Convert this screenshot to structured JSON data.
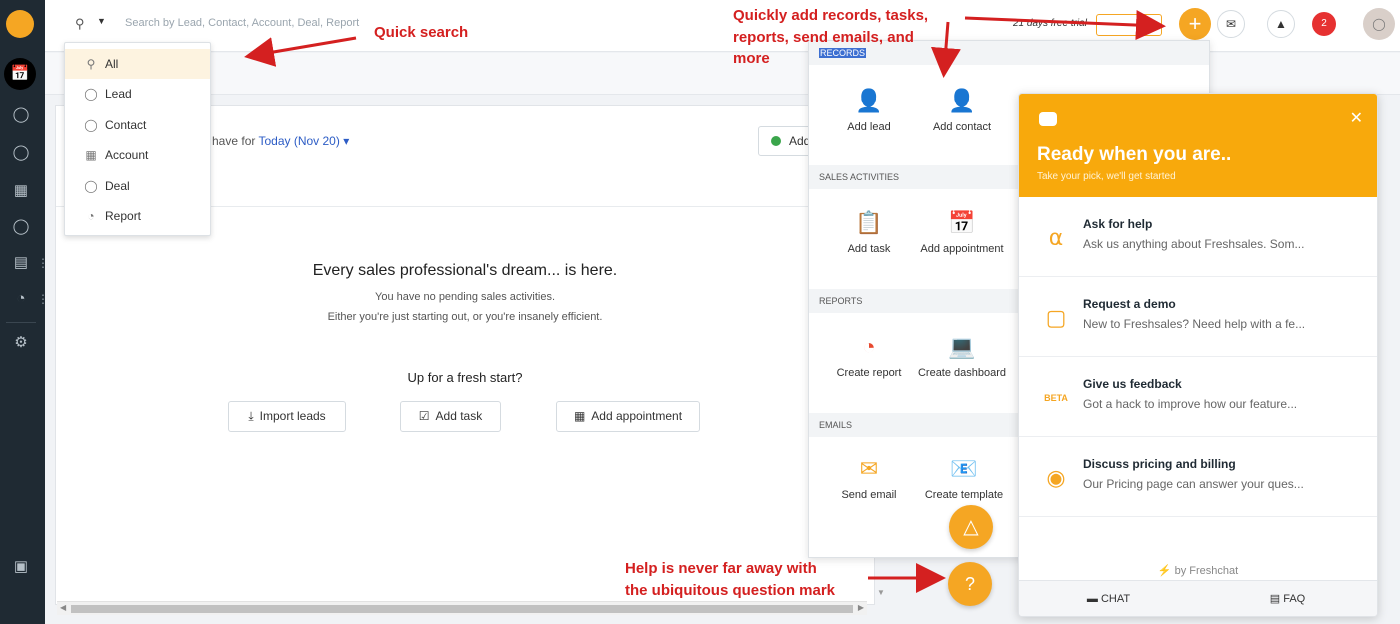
{
  "topbar": {
    "search_placeholder": "Search by Lead, Contact, Account, Deal, Report",
    "trial_text": "21 days free trial",
    "plus_icon": "plus-icon",
    "notification_count": "2"
  },
  "search_menu": {
    "items": [
      {
        "label": "All",
        "icon": "search-icon"
      },
      {
        "label": "Lead",
        "icon": "person-icon"
      },
      {
        "label": "Contact",
        "icon": "person-icon"
      },
      {
        "label": "Account",
        "icon": "building-icon"
      },
      {
        "label": "Deal",
        "icon": "dollar-icon"
      },
      {
        "label": "Report",
        "icon": "pie-chart-icon"
      }
    ]
  },
  "main": {
    "today_prefix": "have for",
    "today_link": "Today (Nov 20)",
    "add_button": "Add",
    "empty_title": "Every sales professional's dream... is here.",
    "empty_line1": "You have no pending sales activities.",
    "empty_line2": "Either you're just starting out, or you're insanely efficient.",
    "fresh_start": "Up for a fresh start?",
    "actions": [
      "Import leads",
      "Add task",
      "Add appointment"
    ]
  },
  "quick_add": {
    "sections": {
      "records": "RECORDS",
      "sales_activities": "SALES ACTIVITIES",
      "reports": "REPORTS",
      "emails": "EMAILS"
    },
    "records": [
      "Add lead",
      "Add contact"
    ],
    "activities": [
      "Add task",
      "Add appointment"
    ],
    "reports": [
      "Create report",
      "Create dashboard"
    ],
    "emails": [
      "Send email",
      "Create template"
    ]
  },
  "chat": {
    "title": "Ready when you are..",
    "subtitle": "Take your pick, we'll get started",
    "options": [
      {
        "title": "Ask for help",
        "desc": "Ask us anything about Freshsales. Som...",
        "icon": "headset-icon"
      },
      {
        "title": "Request a demo",
        "desc": "New to Freshsales? Need help with a fe...",
        "icon": "pointer-icon"
      },
      {
        "title": "Give us feedback",
        "desc": "Got a hack to improve how our feature...",
        "icon": "beta-icon"
      },
      {
        "title": "Discuss pricing and billing",
        "desc": "Our Pricing page can answer your ques...",
        "icon": "coin-hand-icon"
      }
    ],
    "by": "by Freshchat",
    "tabs": [
      "CHAT",
      "FAQ"
    ]
  },
  "annotations": {
    "quick_search": "Quick search",
    "quick_add_1": "Quickly add records, tasks,",
    "quick_add_2": "reports, send emails, and",
    "quick_add_3": "more",
    "help_1": "Help is never far away with",
    "help_2": "the ubiquitous question mark"
  },
  "help_label": "?",
  "colors": {
    "accent": "#f5a623",
    "rail": "#1f2a33",
    "annotation": "#d42020"
  }
}
